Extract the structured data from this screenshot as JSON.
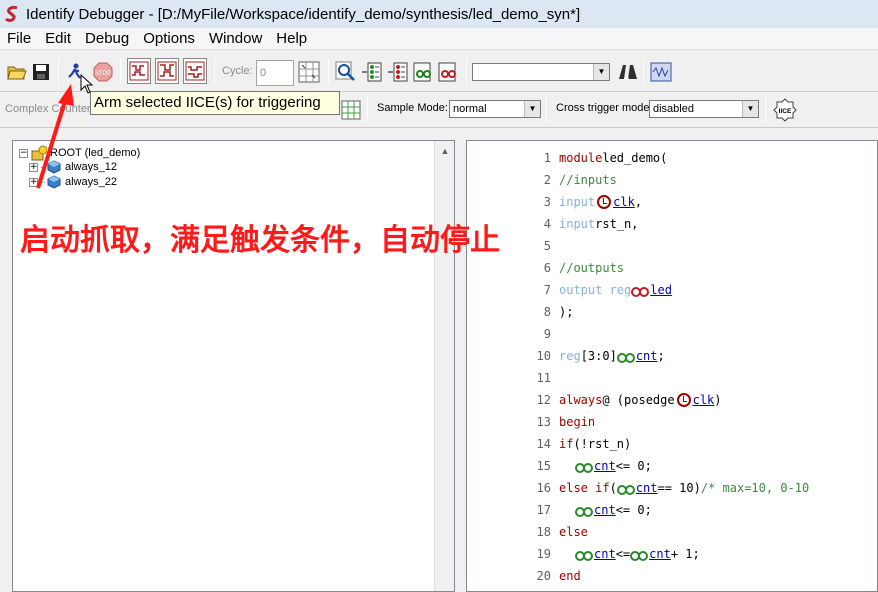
{
  "window": {
    "title": "Identify Debugger - [D:/MyFile/Workspace/identify_demo/synthesis/led_demo_syn*]"
  },
  "menu": [
    "File",
    "Edit",
    "Debug",
    "Options",
    "Window",
    "Help"
  ],
  "toolbar": {
    "cycle_label": "Cycle:",
    "cycle_value": "0",
    "search_value": ""
  },
  "toolbar2": {
    "complex_counter_label": "Complex Counter",
    "sample_mode_label": "Sample Mode:",
    "sample_mode_value": "normal",
    "cross_trigger_label": "Cross trigger mode:",
    "cross_trigger_value": "disabled",
    "iice_label": "IICE"
  },
  "tooltip": "Arm selected IICE(s) for triggering",
  "tree": {
    "root": "ROOT (led_demo)",
    "children": [
      "always_12",
      "always_22"
    ]
  },
  "annotation": "启动抓取，满足触发条件，自动停止",
  "code": {
    "line_numbers": [
      "1",
      "2",
      "3",
      "4",
      "5",
      "6",
      "7",
      "8",
      "9",
      "10",
      "11",
      "12",
      "13",
      "14",
      "15",
      "16",
      "17",
      "18",
      "19",
      "20"
    ],
    "l1_kw": "module",
    "l1_rest": " led_demo(",
    "l2": " //inputs",
    "l3_kw": " input ",
    "l3_sig": "clk",
    "l3_rest": ",",
    "l4_kw": " input",
    "l4_rest": " rst_n,",
    "l6": " //outputs",
    "l7_kw": " output reg ",
    "l7_sig": "led",
    "l8": ");",
    "l10_kw": "reg",
    "l10_rest": " [3:0] ",
    "l10_sig": "cnt",
    "l10_end": ";",
    "l12_kw": "always",
    "l12_rest": " @ (posedge ",
    "l12_sig": "clk",
    "l12_end": ")",
    "l13_kw": "begin",
    "l14_kw": " if",
    "l14_rest": "(!rst_n)",
    "l15_sig": "cnt",
    "l15_rest": " <= 0;",
    "l16_kw": " else if",
    "l16_rest": "(",
    "l16_sig": "cnt",
    "l16_end": " == 10)  ",
    "l16_cm": "/* max=10, 0-10",
    "l17_sig": "cnt",
    "l17_rest": " <= 0;",
    "l18_kw": " else",
    "l19_sig": "cnt",
    "l19_mid": " <= ",
    "l19_sig2": "cnt",
    "l19_rest": " + 1;",
    "l20_kw": "end"
  }
}
